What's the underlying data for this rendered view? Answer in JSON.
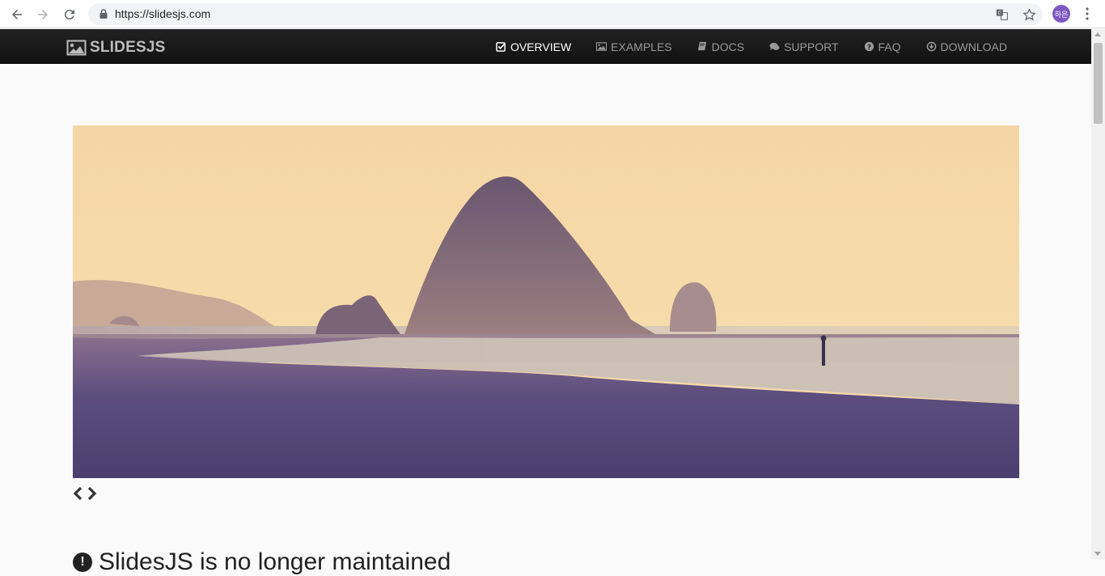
{
  "browser": {
    "url": "https://slidesjs.com",
    "avatar_label": "하은",
    "icons": [
      "back-icon",
      "forward-icon",
      "reload-icon",
      "lock-icon",
      "translate-icon",
      "star-icon",
      "menu-icon"
    ]
  },
  "site": {
    "logo_text": "SLIDESJS",
    "nav": [
      {
        "label": "OVERVIEW",
        "icon": "check-square-icon",
        "active": true
      },
      {
        "label": "EXAMPLES",
        "icon": "picture-icon",
        "active": false
      },
      {
        "label": "DOCS",
        "icon": "book-icon",
        "active": false
      },
      {
        "label": "SUPPORT",
        "icon": "comments-icon",
        "active": false
      },
      {
        "label": "FAQ",
        "icon": "question-circle-icon",
        "active": false
      },
      {
        "label": "DOWNLOAD",
        "icon": "download-circle-icon",
        "active": false
      }
    ]
  },
  "slideshow": {
    "image_description": "beach-haystack-rock-photo",
    "prev_icon": "chevron-left-icon",
    "next_icon": "chevron-right-icon"
  },
  "notice": {
    "text": "SlidesJS is no longer maintained",
    "icon": "exclamation-circle-icon"
  },
  "colors": {
    "navbar": "#111111",
    "nav_active": "#ffffff",
    "nav_inactive": "#999999",
    "page_bg": "#fafafa"
  }
}
